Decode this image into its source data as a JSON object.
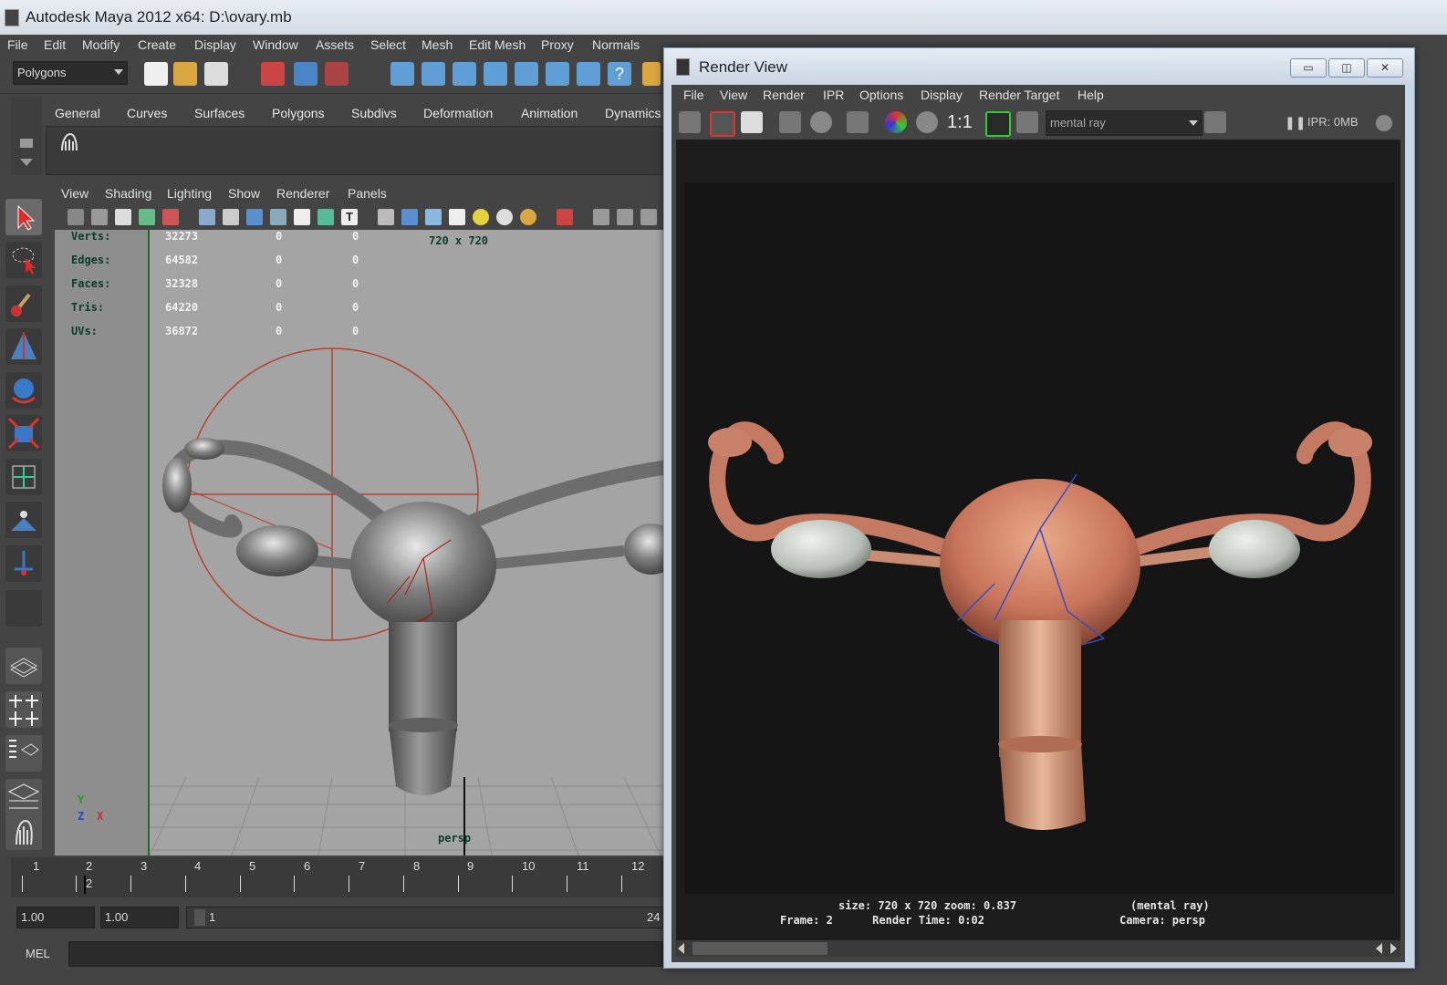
{
  "window": {
    "title": "Autodesk Maya 2012 x64: D:\\ovary.mb"
  },
  "menubar": [
    "File",
    "Edit",
    "Modify",
    "Create",
    "Display",
    "Window",
    "Assets",
    "Select",
    "Mesh",
    "Edit Mesh",
    "Proxy",
    "Normals"
  ],
  "status_line": {
    "menu_set": "Polygons"
  },
  "shelf_tabs": [
    "General",
    "Curves",
    "Surfaces",
    "Polygons",
    "Subdivs",
    "Deformation",
    "Animation",
    "Dynamics"
  ],
  "panel_menu": [
    "View",
    "Shading",
    "Lighting",
    "Show",
    "Renderer",
    "Panels"
  ],
  "hud": {
    "rows": [
      {
        "label": "Verts:",
        "v1": "32273",
        "v2": "0",
        "v3": "0"
      },
      {
        "label": "Edges:",
        "v1": "64582",
        "v2": "0",
        "v3": "0"
      },
      {
        "label": "Faces:",
        "v1": "32328",
        "v2": "0",
        "v3": "0"
      },
      {
        "label": "Tris:",
        "v1": "64220",
        "v2": "0",
        "v3": "0"
      },
      {
        "label": "UVs:",
        "v1": "36872",
        "v2": "0",
        "v3": "0"
      }
    ],
    "resolution": "720 x 720",
    "camera": "persp",
    "axis_y": "Y",
    "axis_z": "Z",
    "axis_x": "X"
  },
  "timeline": {
    "ticks": [
      "1",
      "2",
      "3",
      "4",
      "5",
      "6",
      "7",
      "8",
      "9",
      "10",
      "11",
      "12"
    ],
    "current_frame": "2"
  },
  "range": {
    "start": "1.00",
    "playback_start": "1.00",
    "slider_start": "1",
    "end_partial": "24"
  },
  "command_line": {
    "label": "MEL"
  },
  "render_view": {
    "title": "Render View",
    "menu": [
      "File",
      "View",
      "Render",
      "IPR",
      "Options",
      "Display",
      "Render Target",
      "Help"
    ],
    "ratio": "1:1",
    "renderer": "mental ray",
    "ipr_memory": "IPR: 0MB",
    "info_line1_left": "size: 720 x 720 zoom: 0.837",
    "info_line1_right": "(mental ray)",
    "info_line2_left": "Frame: 2      Render Time: 0:02",
    "info_line2_right": "Camera: persp"
  },
  "colors": {
    "ui_bg": "#444444",
    "viewport_bg": "#a4a4a4",
    "selection_red": "#b5412c",
    "render_bg": "#151515"
  }
}
